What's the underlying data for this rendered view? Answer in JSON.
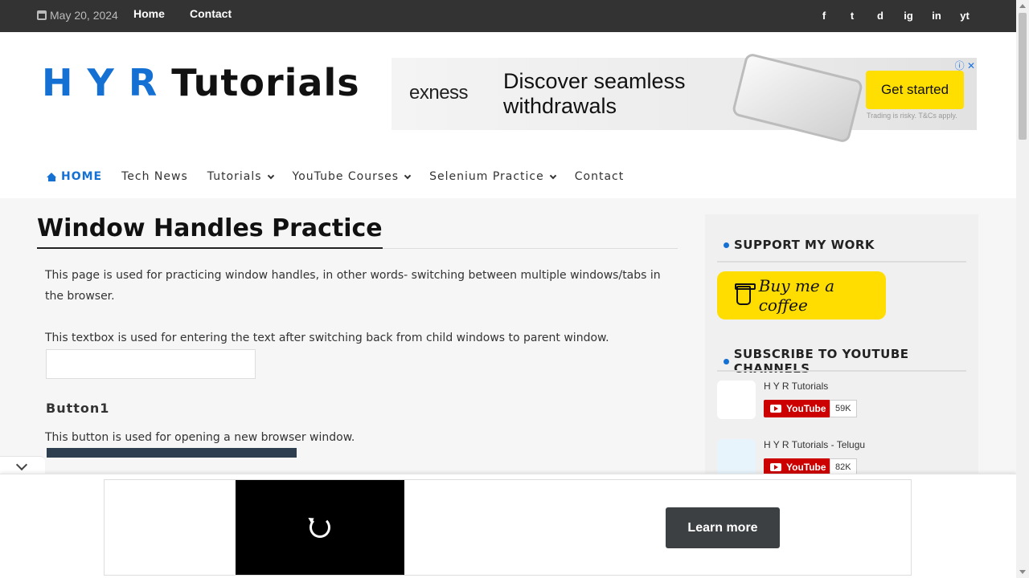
{
  "topbar": {
    "date": "May 20, 2024",
    "links": [
      "Home",
      "Contact"
    ],
    "social": [
      "f",
      "t",
      "d",
      "ig",
      "in",
      "yt"
    ]
  },
  "header": {
    "logo_hyr": "H Y R",
    "logo_rest": "Tutorials"
  },
  "ad_banner": {
    "brand": "exness",
    "headline": "Discover seamless withdrawals",
    "cta": "Get started",
    "fine_print": "Trading is risky. T&Cs apply."
  },
  "nav": {
    "home": "HOME",
    "items": [
      "Tech News",
      "Tutorials",
      "YouTube Courses",
      "Selenium Practice",
      "Contact"
    ]
  },
  "main": {
    "title": "Window Handles Practice",
    "intro": "This page is used for practicing window handles, in other words- switching between multiple windows/tabs in the browser.",
    "textbox_desc": "This textbox is used for entering the text after switching back from child windows to parent window.",
    "section1_heading": "Button1",
    "section1_desc": "This button is used for opening a new browser window."
  },
  "sidebar": {
    "support_title": "SUPPORT MY WORK",
    "coffee_label": "Buy me a coffee",
    "subscribe_title": "SUBSCRIBE TO YOUTUBE CHANNELS",
    "channels": [
      {
        "name": "H Y R Tutorials",
        "button": "YouTube",
        "count": "59K"
      },
      {
        "name": "H Y R Tutorials - Telugu",
        "button": "YouTube",
        "count": "82K"
      }
    ]
  },
  "anchor_ad": {
    "cta": "Learn more"
  },
  "colors": {
    "accent": "#1570d4",
    "topbar": "#333333",
    "coffee": "#ffdd00",
    "youtube": "#cc0000"
  }
}
